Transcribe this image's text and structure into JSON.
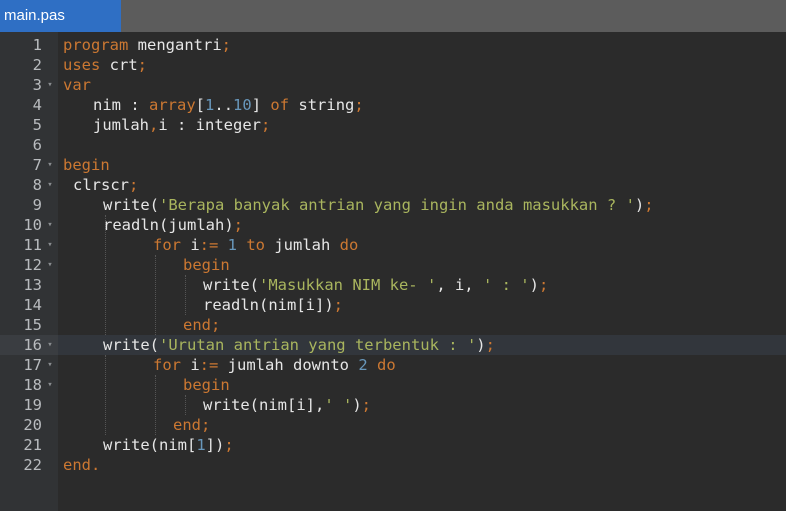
{
  "tab": {
    "title": "main.pas"
  },
  "editor": {
    "active_line": 16,
    "lines": [
      {
        "n": "1",
        "fold": "",
        "indent": 0,
        "tokens": [
          [
            "kw",
            "program"
          ],
          [
            "id",
            " mengantri"
          ],
          [
            "pun",
            ";"
          ]
        ]
      },
      {
        "n": "2",
        "fold": "",
        "indent": 0,
        "tokens": [
          [
            "kw",
            "uses"
          ],
          [
            "id",
            " crt"
          ],
          [
            "pun",
            ";"
          ]
        ]
      },
      {
        "n": "3",
        "fold": "▾",
        "indent": 0,
        "tokens": [
          [
            "kw",
            "var"
          ]
        ]
      },
      {
        "n": "4",
        "fold": "",
        "indent": 3,
        "tokens": [
          [
            "id",
            "nim : "
          ],
          [
            "kw",
            "array"
          ],
          [
            "id",
            "["
          ],
          [
            "num",
            "1"
          ],
          [
            "id",
            ".."
          ],
          [
            "num",
            "10"
          ],
          [
            "id",
            "] "
          ],
          [
            "kw",
            "of"
          ],
          [
            "id",
            " string"
          ],
          [
            "pun",
            ";"
          ]
        ]
      },
      {
        "n": "5",
        "fold": "",
        "indent": 3,
        "tokens": [
          [
            "id",
            "jumlah"
          ],
          [
            "pun",
            ","
          ],
          [
            "id",
            "i : integer"
          ],
          [
            "pun",
            ";"
          ]
        ]
      },
      {
        "n": "6",
        "fold": "",
        "indent": 0,
        "tokens": []
      },
      {
        "n": "7",
        "fold": "▾",
        "indent": 0,
        "tokens": [
          [
            "kw",
            "begin"
          ]
        ]
      },
      {
        "n": "8",
        "fold": "▾",
        "indent": 1,
        "tokens": [
          [
            "id",
            "clrscr"
          ],
          [
            "pun",
            ";"
          ]
        ]
      },
      {
        "n": "9",
        "fold": "",
        "indent": 4,
        "tokens": [
          [
            "id",
            "write("
          ],
          [
            "str",
            "'Berapa banyak antrian yang ingin anda masukkan ? '"
          ],
          [
            "id",
            ")"
          ],
          [
            "pun",
            ";"
          ]
        ]
      },
      {
        "n": "10",
        "fold": "▾",
        "indent": 4,
        "tokens": [
          [
            "id",
            "readln(jumlah)"
          ],
          [
            "pun",
            ";"
          ]
        ]
      },
      {
        "n": "11",
        "fold": "▾",
        "indent": 9,
        "tokens": [
          [
            "kw",
            "for"
          ],
          [
            "id",
            " i"
          ],
          [
            "pun",
            ":="
          ],
          [
            "num",
            " 1"
          ],
          [
            "kw",
            " to"
          ],
          [
            "id",
            " jumlah "
          ],
          [
            "kw",
            "do"
          ]
        ]
      },
      {
        "n": "12",
        "fold": "▾",
        "indent": 12,
        "tokens": [
          [
            "kw",
            "begin"
          ]
        ]
      },
      {
        "n": "13",
        "fold": "",
        "indent": 14,
        "tokens": [
          [
            "id",
            "write("
          ],
          [
            "str",
            "'Masukkan NIM ke- '"
          ],
          [
            "id",
            ", i, "
          ],
          [
            "str",
            "' : '"
          ],
          [
            "id",
            ")"
          ],
          [
            "pun",
            ";"
          ]
        ]
      },
      {
        "n": "14",
        "fold": "",
        "indent": 14,
        "tokens": [
          [
            "id",
            "readln(nim[i])"
          ],
          [
            "pun",
            ";"
          ]
        ]
      },
      {
        "n": "15",
        "fold": "",
        "indent": 12,
        "tokens": [
          [
            "kw",
            "end"
          ],
          [
            "pun",
            ";"
          ]
        ]
      },
      {
        "n": "16",
        "fold": "▾",
        "indent": 4,
        "tokens": [
          [
            "id",
            "write("
          ],
          [
            "str",
            "'Urutan antrian yang terbentuk : '"
          ],
          [
            "id",
            ")"
          ],
          [
            "pun",
            ";"
          ]
        ]
      },
      {
        "n": "17",
        "fold": "▾",
        "indent": 9,
        "tokens": [
          [
            "kw",
            "for"
          ],
          [
            "id",
            " i"
          ],
          [
            "pun",
            ":="
          ],
          [
            "id",
            " jumlah downto "
          ],
          [
            "num",
            "2"
          ],
          [
            "kw",
            " do"
          ]
        ]
      },
      {
        "n": "18",
        "fold": "▾",
        "indent": 12,
        "tokens": [
          [
            "kw",
            "begin"
          ]
        ]
      },
      {
        "n": "19",
        "fold": "",
        "indent": 14,
        "tokens": [
          [
            "id",
            "write(nim[i],"
          ],
          [
            "str",
            "' '"
          ],
          [
            "id",
            ")"
          ],
          [
            "pun",
            ";"
          ]
        ]
      },
      {
        "n": "20",
        "fold": "",
        "indent": 11,
        "tokens": [
          [
            "kw",
            "end"
          ],
          [
            "pun",
            ";"
          ]
        ]
      },
      {
        "n": "21",
        "fold": "",
        "indent": 4,
        "tokens": [
          [
            "id",
            "write(nim["
          ],
          [
            "num",
            "1"
          ],
          [
            "id",
            "])"
          ],
          [
            "pun",
            ";"
          ]
        ]
      },
      {
        "n": "22",
        "fold": "",
        "indent": 0,
        "tokens": [
          [
            "kw",
            "end"
          ],
          [
            "pun",
            "."
          ]
        ]
      }
    ]
  },
  "colors": {
    "tab_active": "#2f6fc4",
    "keyword": "#cc7832",
    "string": "#a9b55e",
    "number": "#6897bb",
    "text": "#e6e6e6"
  }
}
